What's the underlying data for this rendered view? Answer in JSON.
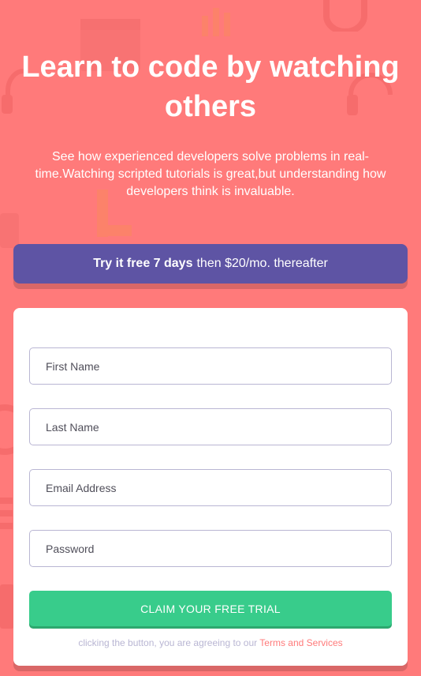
{
  "hero": {
    "title": "Learn to code by watching others",
    "subtitle": "See how experienced developers solve problems in real-time.Watching scripted tutorials is great,but understanding how developers think is invaluable."
  },
  "trial_banner": {
    "bold": "Try it free 7 days",
    "rest": "then $20/mo. thereafter"
  },
  "form": {
    "first_name_placeholder": "First Name",
    "last_name_placeholder": "Last Name",
    "email_placeholder": "Email Address",
    "password_placeholder": "Password",
    "submit_label": "CLAIM YOUR FREE TRIAL",
    "terms_prefix": "clicking the button, you are agreeing to our",
    "terms_link": "Terms and Services"
  },
  "colors": {
    "background": "#ff7a7a",
    "banner": "#5e54a4",
    "cta": "#38cc8b",
    "input_border": "#b9b6d3"
  }
}
